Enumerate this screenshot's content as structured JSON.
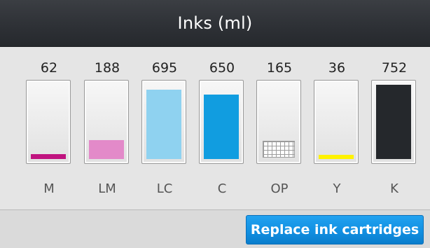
{
  "header": {
    "title": "Inks (ml)"
  },
  "inks": [
    {
      "id": "m",
      "amount": "62",
      "label": "M",
      "fill_color": "#c0137f",
      "level": 0.07
    },
    {
      "id": "lm",
      "amount": "188",
      "label": "LM",
      "fill_color": "#e38ac9",
      "level": 0.25
    },
    {
      "id": "lc",
      "amount": "695",
      "label": "LC",
      "fill_color": "#8fd2f0",
      "level": 0.93
    },
    {
      "id": "c",
      "amount": "650",
      "label": "C",
      "fill_color": "#119de0",
      "level": 0.87
    },
    {
      "id": "op",
      "amount": "165",
      "label": "OP",
      "fill_color": "#ffffff",
      "level": 0.22,
      "pattern": "grid"
    },
    {
      "id": "y",
      "amount": "36",
      "label": "Y",
      "fill_color": "#fff200",
      "level": 0.04
    },
    {
      "id": "k",
      "amount": "752",
      "label": "K",
      "fill_color": "#25282c",
      "level": 1.0
    }
  ],
  "footer": {
    "replace_button_label": "Replace ink cartridges"
  },
  "colors": {
    "accent": "#1190e2",
    "titlebar": "#2d3035",
    "background": "#e5e5e5"
  }
}
